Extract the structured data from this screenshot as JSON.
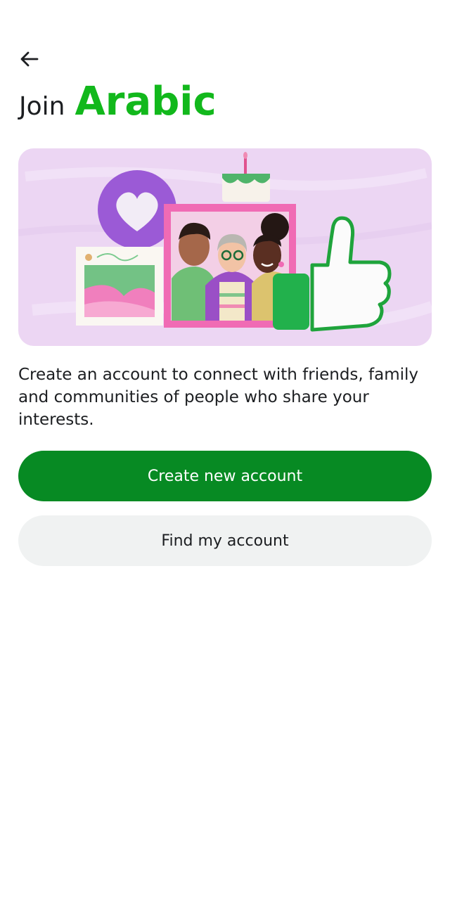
{
  "header": {
    "back_icon": "arrow-left-icon",
    "title_prefix": "Join",
    "title_brand": "Arabic"
  },
  "hero": {
    "image": "friends-group-illustration",
    "elements": [
      "heart-icon",
      "birthday-cake",
      "landscape-picture",
      "group-photo",
      "thumbs-up-icon"
    ]
  },
  "description": "Create an account to connect with friends, family and communities of people who share your interests.",
  "actions": {
    "create_label": "Create new account",
    "find_label": "Find my account"
  },
  "colors": {
    "brand": "#12b81c",
    "primary_button": "#078a23",
    "secondary_button": "#f0f2f2",
    "hero_background": "#ecd6f3"
  }
}
